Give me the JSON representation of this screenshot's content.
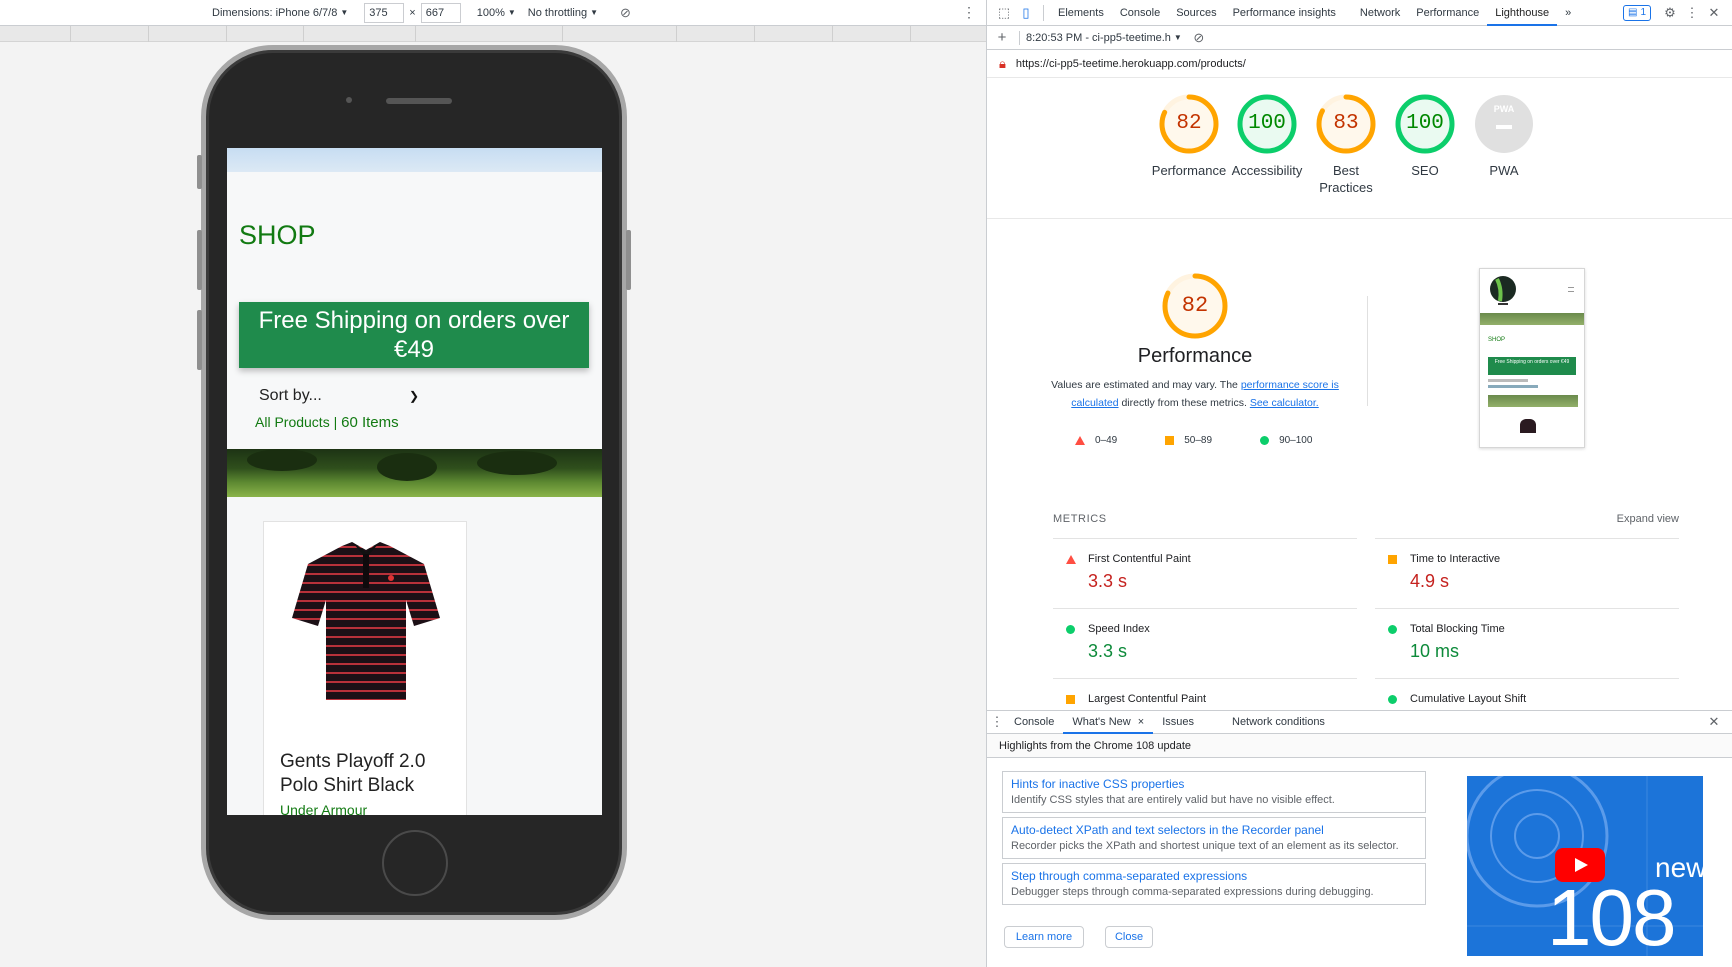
{
  "device_toolbar": {
    "dimensions_label": "Dimensions: iPhone 6/7/8",
    "width": "375",
    "height": "667",
    "times": "×",
    "zoom": "100%",
    "throttling": "No throttling"
  },
  "site": {
    "shop_title": "SHOP",
    "shipping_banner": "Free Shipping on orders over €49",
    "sort_label": "Sort by...",
    "all_products": "All Products",
    "separator": "|",
    "item_count": "60 Items",
    "product": {
      "name": "Gents Playoff 2.0 Polo Shirt Black",
      "brand": "Under Armour"
    }
  },
  "devtools": {
    "tabs": [
      "Elements",
      "Console",
      "Sources",
      "Performance insights",
      "Network",
      "Performance",
      "Lighthouse"
    ],
    "active_tab": "Lighthouse",
    "more_tabs": "»",
    "issues_count": "1",
    "report_selector": "8:20:53 PM - ci-pp5-teetime.h",
    "url": "https://ci-pp5-teetime.herokuapp.com/products/"
  },
  "scores": [
    {
      "value": 82,
      "label": "Performance",
      "color": "#ffa400",
      "text_color": "#c33300"
    },
    {
      "value": 100,
      "label": "Accessibility",
      "color": "#0cce6b",
      "text_color": "#008800"
    },
    {
      "value": 83,
      "label": "Best Practices",
      "color": "#ffa400",
      "text_color": "#c33300"
    },
    {
      "value": 100,
      "label": "SEO",
      "color": "#0cce6b",
      "text_color": "#008800"
    },
    {
      "value": null,
      "label": "PWA",
      "color": "#cccccc",
      "text_color": "#ffffff"
    }
  ],
  "pwa_badge": "PWA",
  "performance": {
    "score": "82",
    "title": "Performance",
    "desc_prefix": "Values are estimated and may vary. The",
    "desc_link1": "performance score is calculated",
    "desc_middle": "directly from these metrics.",
    "desc_link2": "See calculator."
  },
  "legend": [
    {
      "range": "0–49",
      "shape": "triangle",
      "color": "#ff4e42"
    },
    {
      "range": "50–89",
      "shape": "square",
      "color": "#ffa400"
    },
    {
      "range": "90–100",
      "shape": "circle",
      "color": "#0cce6b"
    }
  ],
  "thumbnail": {
    "shop": "SHOP",
    "banner": "Free Shipping on orders over €49"
  },
  "metrics": {
    "heading": "METRICS",
    "expand": "Expand view",
    "items": [
      {
        "title": "First Contentful Paint",
        "value": "3.3 s",
        "status": "fail"
      },
      {
        "title": "Time to Interactive",
        "value": "4.9 s",
        "status": "average"
      },
      {
        "title": "Speed Index",
        "value": "3.3 s",
        "status": "pass"
      },
      {
        "title": "Total Blocking Time",
        "value": "10 ms",
        "status": "pass"
      },
      {
        "title": "Largest Contentful Paint",
        "value": "",
        "status": "average"
      },
      {
        "title": "Cumulative Layout Shift",
        "value": "",
        "status": "pass"
      }
    ]
  },
  "drawer": {
    "tabs": [
      "Console",
      "What's New",
      "Issues",
      "Network conditions"
    ],
    "active_tab": "What's New",
    "close_x": "×",
    "heading": "Highlights from the Chrome 108 update",
    "items": [
      {
        "title": "Hints for inactive CSS properties",
        "desc": "Identify CSS styles that are entirely valid but have no visible effect."
      },
      {
        "title": "Auto-detect XPath and text selectors in the Recorder panel",
        "desc": "Recorder picks the XPath and shortest unique text of an element as its selector."
      },
      {
        "title": "Step through comma-separated expressions",
        "desc": "Debugger steps through comma-separated expressions during debugging."
      }
    ],
    "learn_more": "Learn more",
    "close": "Close",
    "video": {
      "new": "new",
      "version": "108"
    }
  }
}
